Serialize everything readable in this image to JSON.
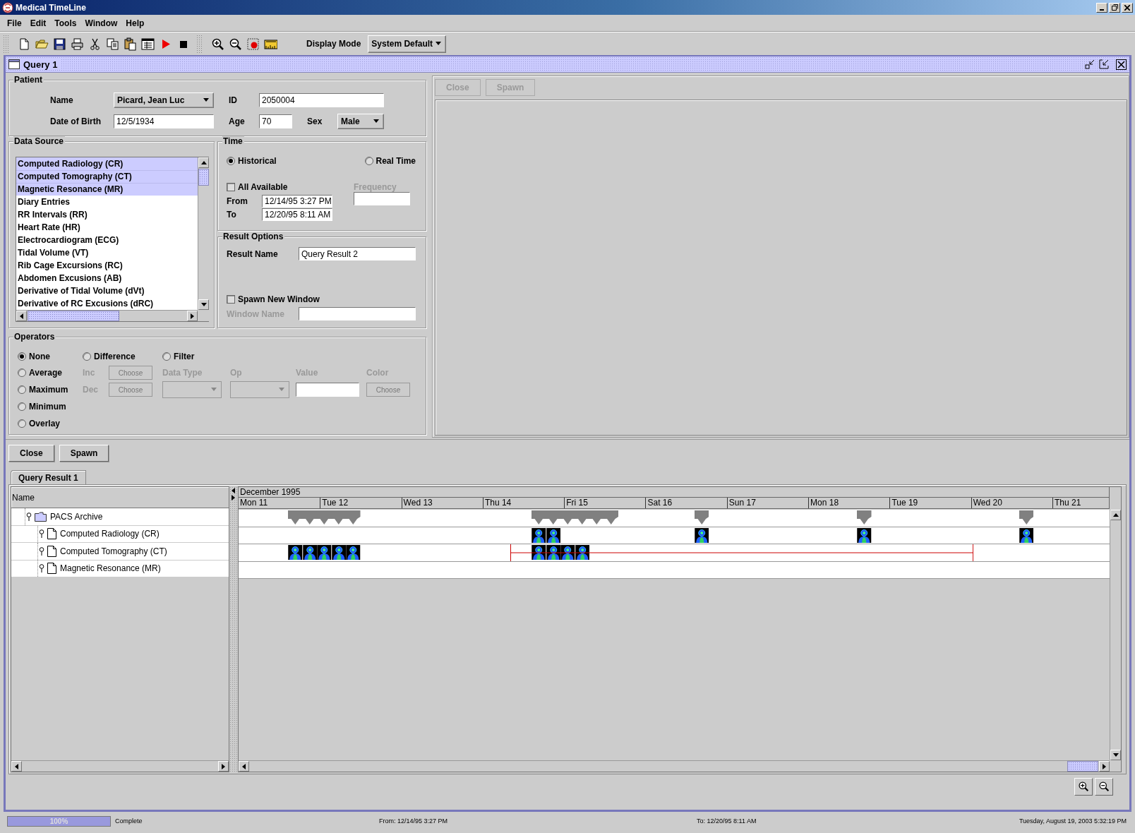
{
  "window": {
    "title": "Medical TimeLine"
  },
  "menu": [
    {
      "label": "File"
    },
    {
      "label": "Edit"
    },
    {
      "label": "Tools"
    },
    {
      "label": "Window"
    },
    {
      "label": "Help"
    }
  ],
  "toolbar": {
    "display_mode_label": "Display Mode",
    "display_mode": "System Default"
  },
  "frame": {
    "title": "Query 1"
  },
  "patient": {
    "title": "Patient",
    "name_label": "Name",
    "name": "Picard, Jean Luc",
    "id_label": "ID",
    "id": "2050004",
    "dob_label": "Date of Birth",
    "dob": "12/5/1934",
    "age_label": "Age",
    "age": "70",
    "sex_label": "Sex",
    "sex": "Male"
  },
  "data_source": {
    "title": "Data Source",
    "items": [
      {
        "label": "Computed Radiology (CR)",
        "selected": true
      },
      {
        "label": "Computed Tomography (CT)",
        "selected": true
      },
      {
        "label": "Magnetic Resonance (MR)",
        "selected": true
      },
      {
        "label": "Diary Entries",
        "selected": false
      },
      {
        "label": "RR Intervals (RR)",
        "selected": false
      },
      {
        "label": "Heart Rate (HR)",
        "selected": false
      },
      {
        "label": "Electrocardiogram (ECG)",
        "selected": false
      },
      {
        "label": "Tidal Volume (VT)",
        "selected": false
      },
      {
        "label": "Rib Cage Excursions (RC)",
        "selected": false
      },
      {
        "label": "Abdomen Excusions (AB)",
        "selected": false
      },
      {
        "label": "Derivative of Tidal Volume (dVt)",
        "selected": false
      },
      {
        "label": "Derivative of RC Excusions (dRC)",
        "selected": false
      }
    ]
  },
  "time": {
    "title": "Time",
    "modes": [
      {
        "label": "Historical",
        "selected": true
      },
      {
        "label": "Real Time",
        "selected": false
      }
    ],
    "all_available": {
      "label": "All Available",
      "checked": false
    },
    "frequency_label": "Frequency",
    "from_label": "From",
    "from": "12/14/95 3:27 PM",
    "to_label": "To",
    "to": "12/20/95 8:11 AM"
  },
  "result_options": {
    "title": "Result Options",
    "result_name_label": "Result Name",
    "result_name": "Query Result 2",
    "spawn_new_window": {
      "label": "Spawn New Window",
      "checked": false
    },
    "window_name_label": "Window Name"
  },
  "operators": {
    "title": "Operators",
    "options": [
      {
        "label": "None",
        "selected": true
      },
      {
        "label": "Difference",
        "selected": false
      },
      {
        "label": "Filter",
        "selected": false
      },
      {
        "label": "Average",
        "selected": false
      },
      {
        "label": "Maximum",
        "selected": false
      },
      {
        "label": "Minimum",
        "selected": false
      },
      {
        "label": "Overlay",
        "selected": false
      }
    ],
    "inc_label": "Inc",
    "dec_label": "Dec",
    "inc_button": "Choose",
    "dec_button": "Choose",
    "data_type_label": "Data Type",
    "op_label": "Op",
    "value_label": "Value",
    "color_label": "Color",
    "color_button": "Choose"
  },
  "preview_buttons": [
    {
      "label": "Close",
      "disabled": true
    },
    {
      "label": "Spawn",
      "disabled": true
    }
  ],
  "result_buttons": [
    {
      "label": "Close",
      "disabled": false
    },
    {
      "label": "Spawn",
      "disabled": false
    }
  ],
  "result_tabs": [
    {
      "label": "Query Result 1",
      "selected": true
    }
  ],
  "tree": {
    "header": "Name",
    "items": [
      {
        "label": "PACS Archive",
        "kind": "folder",
        "children": [
          {
            "label": "Computed Radiology (CR)",
            "kind": "document"
          },
          {
            "label": "Computed Tomography (CT)",
            "kind": "document"
          },
          {
            "label": "Magnetic Resonance (MR)",
            "kind": "document"
          }
        ]
      }
    ]
  },
  "timeline": {
    "month": "December 1995",
    "days": [
      "Mon 11",
      "Tue 12",
      "Wed 13",
      "Thu 14",
      "Fri 15",
      "Sat 16",
      "Sun 17",
      "Mon 18",
      "Tue 19",
      "Wed 20",
      "Thu 21"
    ]
  },
  "status_bar": {
    "progress": {
      "level": 1,
      "label": "100%"
    },
    "status": "Complete",
    "from": "From:  12/14/95 3:27 PM",
    "to": "To:  12/20/95 8:11 AM",
    "datetime": "Tuesday, August 19, 2003 5:32:19 PM"
  }
}
